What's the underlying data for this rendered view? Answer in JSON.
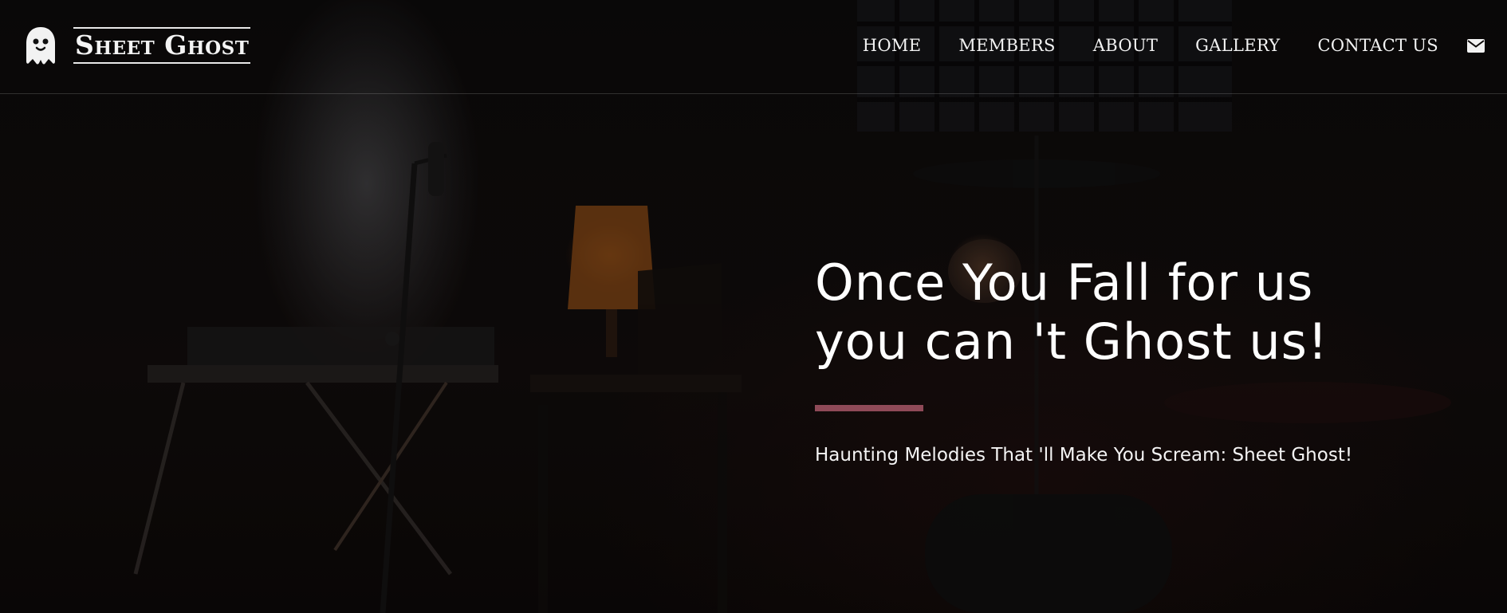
{
  "brand": {
    "name": "Sheet Ghost",
    "logo_icon": "ghost-icon"
  },
  "nav": {
    "items": [
      {
        "label": "HOME"
      },
      {
        "label": "MEMBERS"
      },
      {
        "label": "ABOUT"
      },
      {
        "label": "GALLERY"
      },
      {
        "label": "CONTACT US"
      }
    ],
    "mail_icon": "envelope-icon"
  },
  "hero": {
    "title_line1": "Once You Fall for us",
    "title_line2": "you can 't Ghost us!",
    "subtitle": "Haunting Melodies That 'll Make You Scream: Sheet Ghost!",
    "accent_color": "#8f4a58",
    "background_image": "dark rehearsal room with microphone stand, keyboard, lamp, chair and drum kit"
  },
  "colors": {
    "background": "#0c0908",
    "text": "#ffffff",
    "accent": "#8f4a58"
  }
}
